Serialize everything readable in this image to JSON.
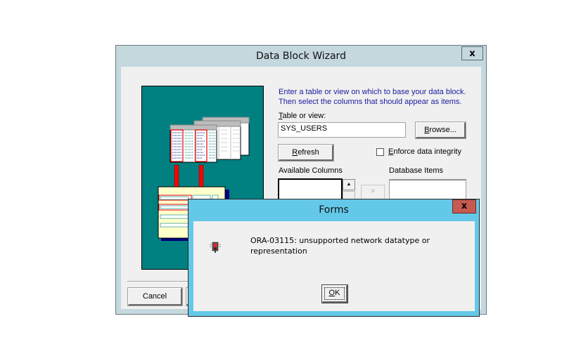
{
  "wizard": {
    "title": "Data Block Wizard",
    "close_label": "x",
    "instructions_line1": "Enter a table or view on which to base your data block.",
    "instructions_line2": "Then select the columns that should appear as items.",
    "table_label_accel": "T",
    "table_label_rest": "able or view:",
    "table_value": "SYS_USERS",
    "browse_accel": "B",
    "browse_rest": "rowse...",
    "refresh_accel": "R",
    "refresh_rest": "efresh",
    "enforce_accel": "E",
    "enforce_rest": "nforce data integrity",
    "enforce_checked": false,
    "available_columns_label": "Available Columns",
    "database_items_label": "Database Items",
    "move_button_label": ">",
    "scroll_up_glyph": "▲",
    "cancel_label": "Cancel"
  },
  "dialog": {
    "title": "Forms",
    "close_label": "x",
    "message": "ORA-03115: unsupported network datatype or representation",
    "icon": "traffic-light-stop-icon",
    "ok_accel": "O",
    "ok_rest": "K"
  },
  "colors": {
    "window_frame": "#c4d8de",
    "dialog_frame": "#64c8e8",
    "dialog_close": "#c75a50",
    "illustration_bg": "#008080",
    "instruction_text": "#1a1aa0"
  }
}
